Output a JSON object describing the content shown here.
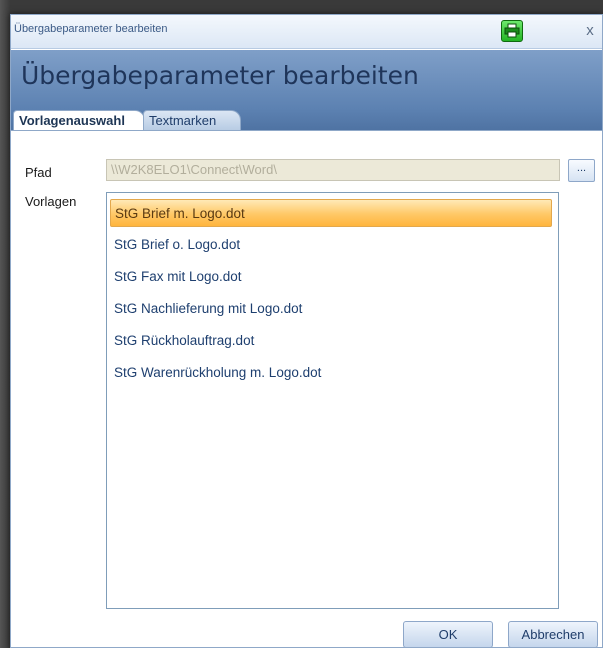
{
  "window": {
    "title": "Übergabeparameter bearbeiten",
    "heading": "Übergabeparameter bearbeiten",
    "print_icon": "printer-icon",
    "close_glyph": "x"
  },
  "tabs": [
    {
      "label": "Vorlagenauswahl",
      "active": true
    },
    {
      "label": "Textmarken",
      "active": false
    }
  ],
  "form": {
    "path_label": "Pfad",
    "path_value": "\\\\W2K8ELO1\\Connect\\Word\\",
    "browse_label": "...",
    "templates_label": "Vorlagen"
  },
  "templates": [
    {
      "label": "StG Brief m. Logo.dot",
      "selected": true
    },
    {
      "label": "StG Brief o. Logo.dot",
      "selected": false
    },
    {
      "label": "StG Fax mit Logo.dot",
      "selected": false
    },
    {
      "label": "StG Nachlieferung mit Logo.dot",
      "selected": false
    },
    {
      "label": "StG Rückholauftrag.dot",
      "selected": false
    },
    {
      "label": "StG Warenrückholung m. Logo.dot",
      "selected": false
    }
  ],
  "buttons": {
    "ok": "OK",
    "cancel": "Abbrechen"
  },
  "colors": {
    "header_band": "#6f91be",
    "selection": "#ffc866",
    "list_text": "#1e3f6f"
  }
}
